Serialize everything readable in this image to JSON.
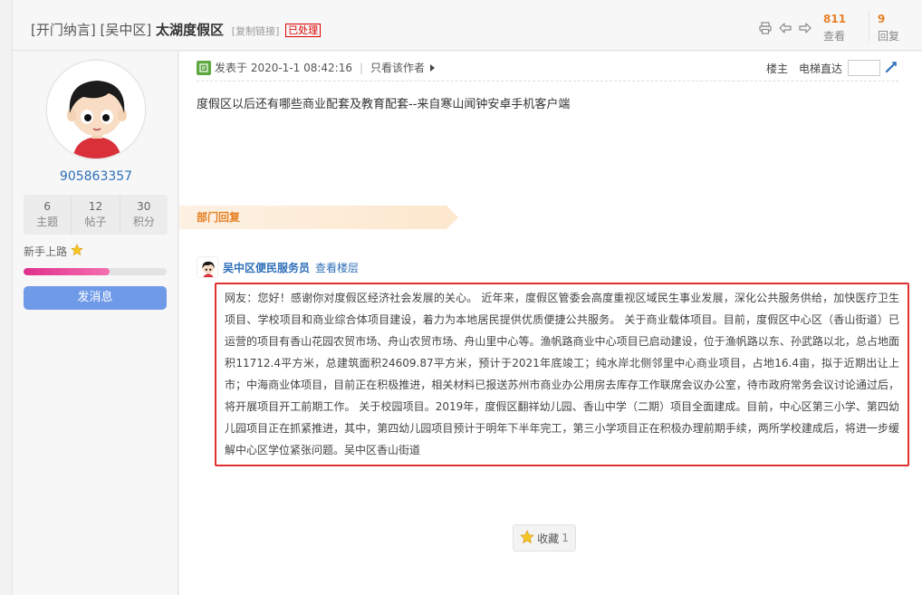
{
  "header": {
    "tag1": "[开门纳言]",
    "tag2": "[吴中区]",
    "title": "太湖度假区",
    "copy_link": "[复制链接]",
    "status_badge": "已处理",
    "views_count": "811",
    "views_label": "查看",
    "replies_count": "9",
    "replies_label": "回复"
  },
  "sidebar": {
    "username": "905863357",
    "stats": [
      {
        "value": "6",
        "label": "主题"
      },
      {
        "value": "12",
        "label": "帖子"
      },
      {
        "value": "30",
        "label": "积分"
      }
    ],
    "level": "新手上路",
    "level_progress": 0.6,
    "message_button": "发消息"
  },
  "post": {
    "posted_label": "发表于 2020-1-1 08:42:16",
    "author_only": "只看该作者",
    "floor_owner": "楼主",
    "elevator_label": "电梯直达",
    "content": "度假区以后还有哪些商业配套及教育配套--来自寒山闻钟安卓手机客户端"
  },
  "reply": {
    "section_label": "部门回复",
    "replier_name": "吴中区便民服务员",
    "view_floor": "查看楼层",
    "content": "网友：您好！感谢你对度假区经济社会发展的关心。 近年来，度假区管委会高度重视区域民生事业发展，深化公共服务供给，加快医疗卫生项目、学校项目和商业综合体项目建设，着力为本地居民提供优质便捷公共服务。 关于商业载体项目。目前，度假区中心区（香山街道）已运营的项目有香山花园农贸市场、舟山农贸市场、舟山里中心等。渔帆路商业中心项目已启动建设，位于渔帆路以东、孙武路以北，总占地面积11712.4平方米，总建筑面积24609.87平方米，预计于2021年底竣工；纯水岸北侧邻里中心商业项目，占地16.4亩，拟于近期出让上市；中海商业体项目，目前正在积极推进，相关材料已报送苏州市商业办公用房去库存工作联席会议办公室，待市政府常务会议讨论通过后，将开展项目开工前期工作。 关于校园项目。2019年，度假区翻祥幼儿园、香山中学（二期）项目全面建成。目前，中心区第三小学、第四幼儿园项目正在抓紧推进，其中，第四幼儿园项目预计于明年下半年完工，第三小学项目正在积极办理前期手续，两所学校建成后，将进一步缓解中心区学位紧张问题。吴中区香山街道"
  },
  "favorite": {
    "label": "收藏",
    "count": "1"
  },
  "colors": {
    "accent_blue": "#2e6fb8",
    "orange": "#e87f26",
    "highlight_red": "#e02f2f",
    "button_blue": "#6f9ae8",
    "badge_red": "#dd0000"
  },
  "icons": [
    "print-icon",
    "prev-arrow-icon",
    "next-arrow-icon",
    "post-icon",
    "star-icon",
    "jump-icon"
  ]
}
